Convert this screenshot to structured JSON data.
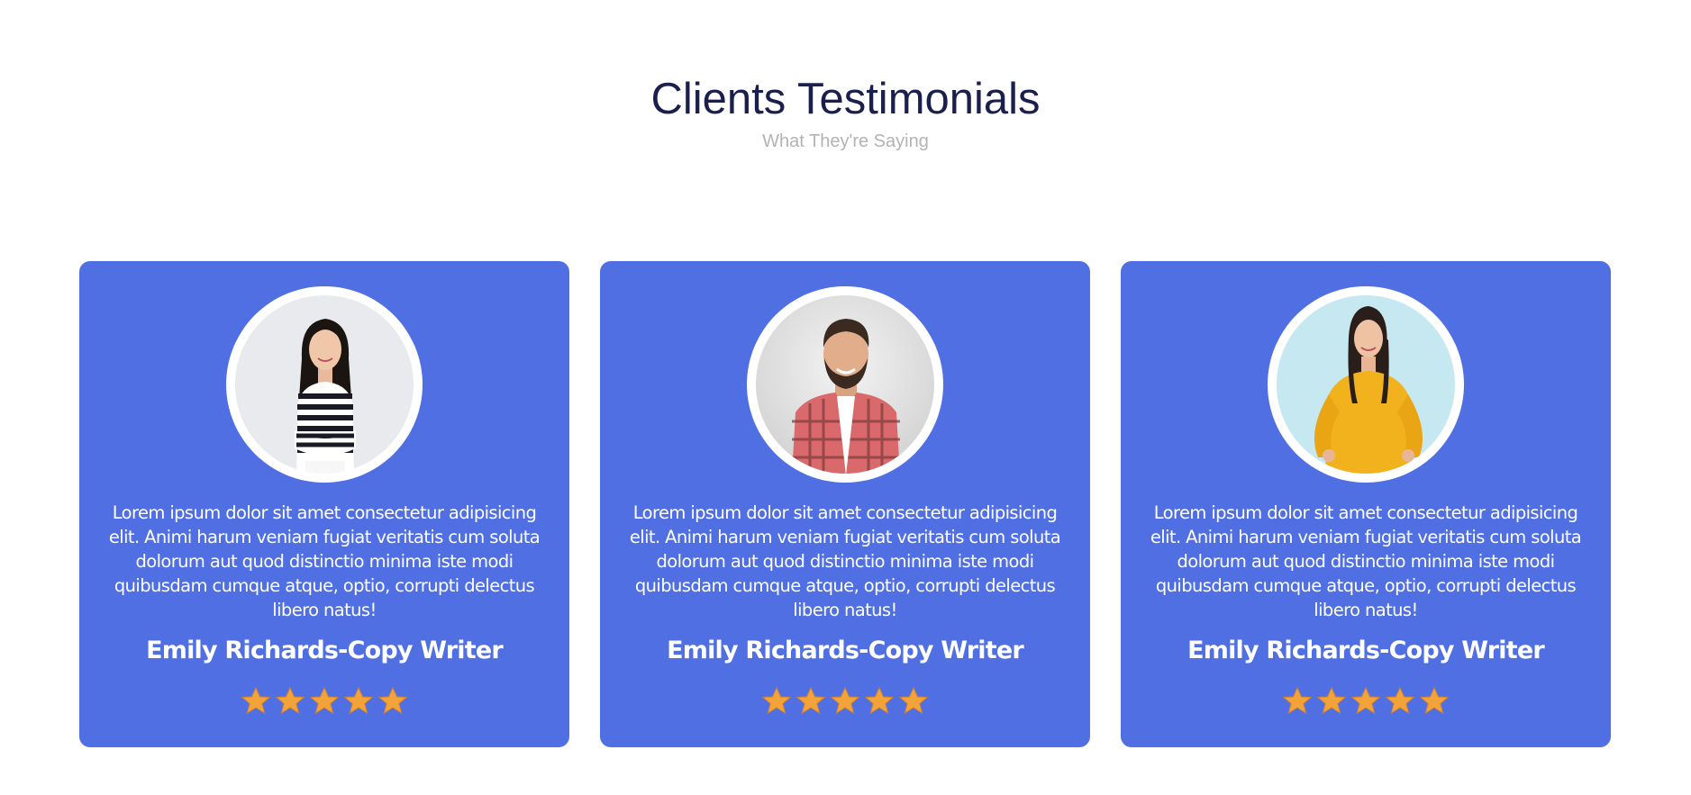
{
  "header": {
    "title": "Clients Testimonials",
    "subtitle": "What They're Saying"
  },
  "colors": {
    "title": "#1a1f4e",
    "subtitle": "#b3b3b3",
    "card_background": "#4f6fe3",
    "star": "#f2a43a"
  },
  "testimonials": [
    {
      "avatar": "woman-striped-shirt-photo",
      "quote": "Lorem ipsum dolor sit amet consectetur adipisicing elit. Animi harum veniam fugiat veritatis cum soluta dolorum aut quod distinctio minima iste modi quibusdam cumque atque, optio, corrupti delectus libero natus!",
      "author": "Emily Richards-Copy Writer",
      "rating": 5
    },
    {
      "avatar": "man-plaid-shirt-photo",
      "quote": "Lorem ipsum dolor sit amet consectetur adipisicing elit. Animi harum veniam fugiat veritatis cum soluta dolorum aut quod distinctio minima iste modi quibusdam cumque atque, optio, corrupti delectus libero natus!",
      "author": "Emily Richards-Copy Writer",
      "rating": 5
    },
    {
      "avatar": "woman-yellow-sweater-photo",
      "quote": "Lorem ipsum dolor sit amet consectetur adipisicing elit. Animi harum veniam fugiat veritatis cum soluta dolorum aut quod distinctio minima iste modi quibusdam cumque atque, optio, corrupti delectus libero natus!",
      "author": "Emily Richards-Copy Writer",
      "rating": 5
    }
  ]
}
